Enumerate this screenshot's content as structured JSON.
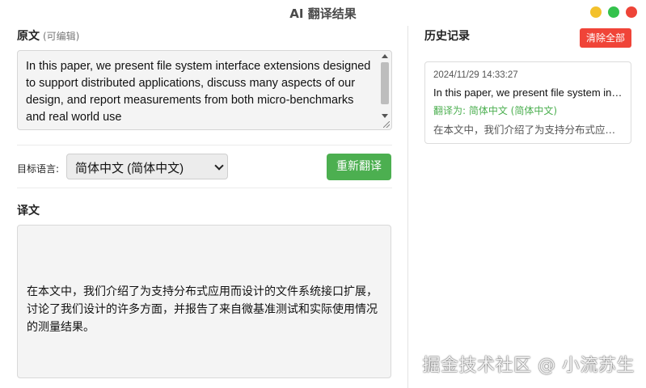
{
  "window": {
    "title": "AI 翻译结果"
  },
  "source": {
    "title": "原文",
    "subtitle": "(可编辑)",
    "text": "In this paper, we present file system interface extensions designed to support distributed applications, discuss many aspects of our design, and report measurements from both micro-benchmarks and real world use"
  },
  "language": {
    "label": "目标语言:",
    "selected": "简体中文 (简体中文)",
    "retranslate_label": "重新翻译"
  },
  "target": {
    "title": "译文",
    "text": "在本文中，我们介绍了为支持分布式应用而设计的文件系统接口扩展，讨论了我们设计的许多方面，并报告了来自微基准测试和实际使用情况的测量结果。"
  },
  "history": {
    "title": "历史记录",
    "clear_label": "清除全部",
    "items": [
      {
        "time": "2024/11/29 14:33:27",
        "source": "In this paper, we present file system interface extensions designed to support distributed applications",
        "lang": "翻译为: 简体中文 (简体中文)",
        "target": "在本文中，我们介绍了为支持分布式应用而设计的文件系统接口扩展"
      }
    ]
  },
  "watermark": "掘金技术社区 @ 小流苏生",
  "colors": {
    "accent_green": "#4caf50",
    "danger_red": "#f04438",
    "traffic_yellow": "#f3c12c",
    "traffic_green": "#34c24d",
    "traffic_red": "#ee4438"
  }
}
